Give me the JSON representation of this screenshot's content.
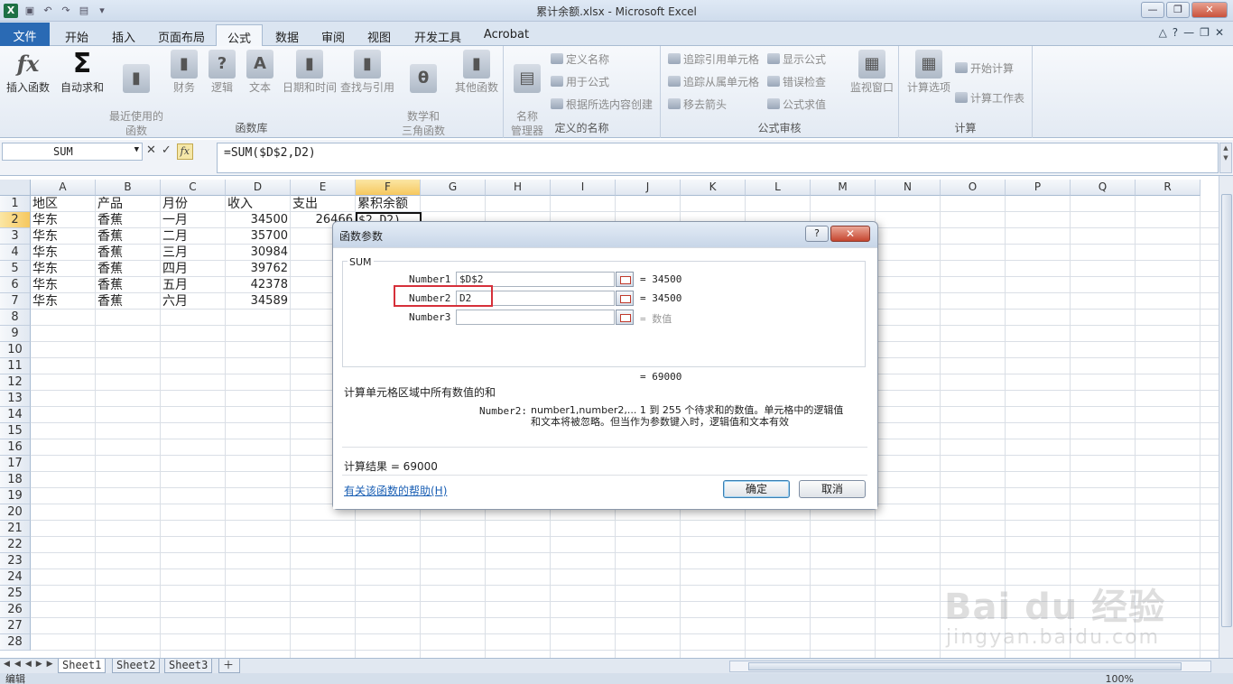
{
  "window": {
    "title": "累计余额.xlsx - Microsoft Excel"
  },
  "tabs": [
    "文件",
    "开始",
    "插入",
    "页面布局",
    "公式",
    "数据",
    "审阅",
    "视图",
    "开发工具",
    "Acrobat"
  ],
  "active_tab": "公式",
  "ribbon": {
    "function_library": {
      "label": "函数库",
      "insert_function": "插入函数",
      "autosum": "自动求和",
      "recent": "最近使用的\n函数",
      "financial": "财务",
      "logical": "逻辑",
      "text": "文本",
      "datetime": "日期和时间",
      "lookup": "查找与引用",
      "math": "数学和\n三角函数",
      "other": "其他函数"
    },
    "defined_names": {
      "label": "定义的名称",
      "name_manager": "名称\n管理器",
      "define_name": "定义名称",
      "use_in_formula": "用于公式",
      "create_from_selection": "根据所选内容创建"
    },
    "formula_auditing": {
      "label": "公式审核",
      "trace_precedents": "追踪引用单元格",
      "trace_dependents": "追踪从属单元格",
      "remove_arrows": "移去箭头",
      "show_formulas": "显示公式",
      "error_checking": "错误检查",
      "evaluate_formula": "公式求值",
      "watch_window": "监视窗口"
    },
    "calculation": {
      "label": "计算",
      "calc_options": "计算选项",
      "calc_now": "开始计算",
      "calc_sheet": "计算工作表"
    }
  },
  "formula_bar": {
    "name_box": "SUM",
    "formula": "=SUM($D$2,D2)"
  },
  "columns": [
    "A",
    "B",
    "C",
    "D",
    "E",
    "F",
    "G",
    "H",
    "I",
    "J",
    "K",
    "L",
    "M",
    "N",
    "O",
    "P",
    "Q",
    "R"
  ],
  "rows": [
    "1",
    "2",
    "3",
    "4",
    "5",
    "6",
    "7",
    "8",
    "9",
    "10",
    "11",
    "12",
    "13",
    "14",
    "15",
    "16",
    "17",
    "18",
    "19",
    "20",
    "21",
    "22",
    "23",
    "24",
    "25",
    "26",
    "27",
    "28"
  ],
  "sheet_rows": [
    [
      "地区",
      "产品",
      "月份",
      "收入",
      "支出",
      "累积余额"
    ],
    [
      "华东",
      "香蕉",
      "一月",
      "34500",
      "26466",
      "$2,D2)"
    ],
    [
      "华东",
      "香蕉",
      "二月",
      "35700",
      "6",
      ""
    ],
    [
      "华东",
      "香蕉",
      "三月",
      "30984",
      "27",
      ""
    ],
    [
      "华东",
      "香蕉",
      "四月",
      "39762",
      "24",
      ""
    ],
    [
      "华东",
      "香蕉",
      "五月",
      "42378",
      "23",
      ""
    ],
    [
      "华东",
      "香蕉",
      "六月",
      "34589",
      "2",
      ""
    ]
  ],
  "dialog": {
    "title": "函数参数",
    "function_name": "SUM",
    "args": [
      {
        "label": "Number1",
        "value": "$D$2",
        "result": "=  34500"
      },
      {
        "label": "Number2",
        "value": "D2",
        "result": "=  34500"
      },
      {
        "label": "Number3",
        "value": "",
        "result": "=  数值"
      }
    ],
    "total": "=  69000",
    "description": "计算单元格区域中所有数值的和",
    "arg_help_label": "Number2:",
    "arg_help_text": "number1,number2,... 1 到 255 个待求和的数值。单元格中的逻辑值\n和文本将被忽略。但当作为参数键入时，逻辑值和文本有效",
    "result_line": "计算结果 = 69000",
    "help_link": "有关该函数的帮助(H)",
    "ok": "确定",
    "cancel": "取消"
  },
  "sheets": [
    "Sheet1",
    "Sheet2",
    "Sheet3"
  ],
  "status": {
    "mode": "编辑",
    "zoom": "100%"
  },
  "watermark": {
    "brand": "Bai du 经验",
    "url": "jingyan.baidu.com"
  }
}
